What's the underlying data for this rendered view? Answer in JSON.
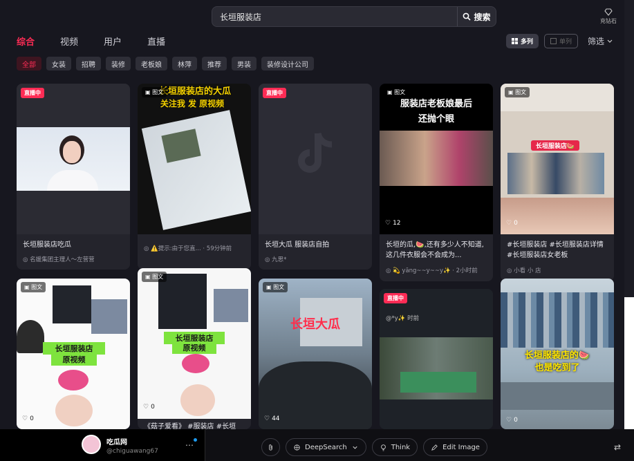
{
  "search": {
    "value": "长垣服装店",
    "button_label": "搜索"
  },
  "top_right": {
    "label": "充钻石"
  },
  "tabs": [
    {
      "label": "综合",
      "active": true
    },
    {
      "label": "视频",
      "active": false
    },
    {
      "label": "用户",
      "active": false
    },
    {
      "label": "直播",
      "active": false
    }
  ],
  "view": {
    "multi_label": "多列",
    "single_label": "单列",
    "filter_label": "筛选"
  },
  "chips": [
    {
      "label": "全部",
      "active": true
    },
    {
      "label": "女装"
    },
    {
      "label": "招聘"
    },
    {
      "label": "装修"
    },
    {
      "label": "老板娘"
    },
    {
      "label": "林萍"
    },
    {
      "label": "推荐"
    },
    {
      "label": "男装"
    },
    {
      "label": "装修设计公司"
    }
  ],
  "badges": {
    "live": "直播中",
    "post": "图文"
  },
  "cards": {
    "c1": {
      "title": "长垣服装店吃瓜",
      "author": "名媛集团主理人～左营营"
    },
    "c2": {
      "overlay1": "长垣服装店的大瓜",
      "overlay2": "关注我 发 原视频",
      "meta": "⚠️提示:由于您直...",
      "time": "· 59分钟前"
    },
    "c3": {
      "title": "长垣大瓜 服装店自拍",
      "author": "九思*"
    },
    "c4": {
      "overlay1": "服装店老板娘最后",
      "overlay2": "还抛个眼",
      "likes": "12",
      "title": "长垣的瓜,🍉,还有多少人不知道,这几件衣服会不会成为...",
      "author": "💫 yāng~~y~~y✨",
      "time": "· 2小时前"
    },
    "c5": {
      "overlay": "长垣服装店🍉",
      "likes": "0",
      "title": "#长垣服装店 #长垣服装店详情 #长垣服装店女老板",
      "author": "小看 小 店",
      "extra": "#长 店女老"
    },
    "c6": {
      "overlay1": "长垣服装店",
      "overlay2": "原视频",
      "likes": "0"
    },
    "c7": {
      "overlay1": "长垣服装店",
      "overlay2": "原视频",
      "likes": "0",
      "title": "《菇子爱看》 #服装店 #长垣"
    },
    "c8": {
      "overlay": "长垣大瓜",
      "likes": "44"
    },
    "c9": {
      "meta": "@*y✨",
      "time": "时前"
    },
    "c10": {
      "overlay1": "长垣服装店的🍉",
      "overlay2": "也是吃到了",
      "likes": "0"
    }
  },
  "profile": {
    "name": "吃瓜网",
    "handle": "@chiguawang67",
    "more": "⋯"
  },
  "tools": [
    {
      "label": "DeepSearch",
      "icon": "search-arrows-icon"
    },
    {
      "label": "Think",
      "icon": "lightbulb-icon"
    },
    {
      "label": "Edit Image",
      "icon": "pencil-icon"
    }
  ]
}
